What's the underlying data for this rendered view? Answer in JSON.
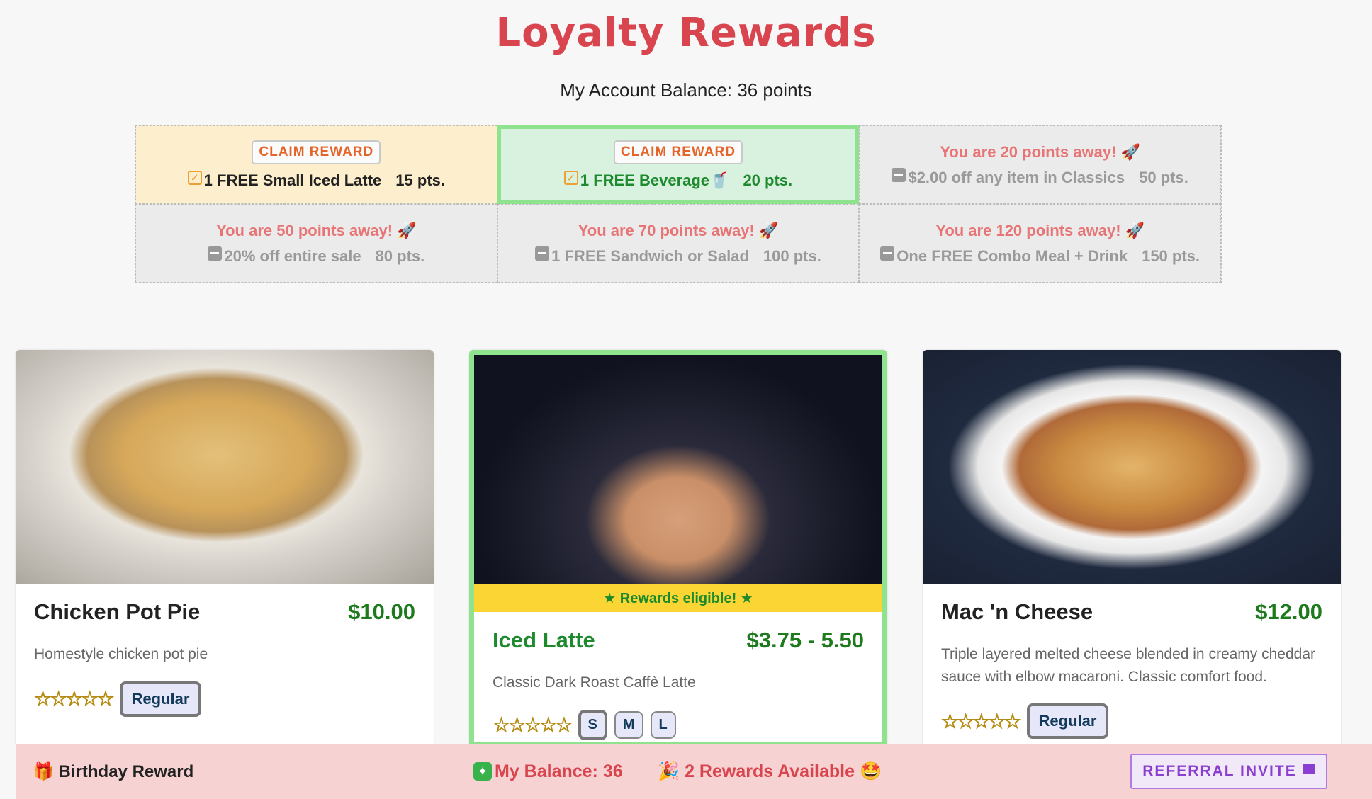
{
  "header": {
    "title": "Loyalty Rewards",
    "balance_text": "My Account Balance: 36 points"
  },
  "rewards": [
    {
      "status": "claimable",
      "claim_label": "CLAIM REWARD",
      "name": "1 FREE Small Iced Latte",
      "points": "15 pts."
    },
    {
      "status": "claimable",
      "claim_label": "CLAIM REWARD",
      "name": "1 FREE Beverage🥤",
      "points": "20 pts."
    },
    {
      "status": "locked",
      "away_text": "You are 20 points away! 🚀",
      "name": "$2.00 off any item in Classics",
      "points": "50 pts."
    },
    {
      "status": "locked",
      "away_text": "You are 50 points away! 🚀",
      "name": "20% off entire sale",
      "points": "80 pts."
    },
    {
      "status": "locked",
      "away_text": "You are 70 points away! 🚀",
      "name": "1 FREE Sandwich or Salad",
      "points": "100 pts."
    },
    {
      "status": "locked",
      "away_text": "You are 120 points away! 🚀",
      "name": "One FREE Combo Meal + Drink",
      "points": "150 pts."
    }
  ],
  "products": [
    {
      "name": "Chicken Pot Pie",
      "price": "$10.00",
      "description": "Homestyle chicken pot pie",
      "stars": "☆☆☆☆☆",
      "options": [
        "Regular"
      ]
    },
    {
      "name": "Iced Latte",
      "price": "$3.75 - 5.50",
      "banner": "★ Rewards eligible! ★",
      "description": "Classic Dark Roast Caffè Latte",
      "stars": "☆☆☆☆☆",
      "options": [
        "S",
        "M",
        "L"
      ],
      "selected_option": "S"
    },
    {
      "name": "Mac 'n Cheese",
      "price": "$12.00",
      "description": "Triple layered melted cheese blended in creamy cheddar sauce with elbow macaroni. Classic comfort food.",
      "stars": "☆☆☆☆☆",
      "options": [
        "Regular"
      ]
    }
  ],
  "footer": {
    "birthday": "🎁 Birthday Reward",
    "balance": "My Balance: 36",
    "balance_icon": "✦",
    "rewards_available": "🎉 2 Rewards Available 🤩",
    "referral_label": "REFERRAL INVITE"
  },
  "colors": {
    "title": "#d9454f",
    "claim_highlight": "#8fe38f",
    "price": "#1d7a1d",
    "banner": "#fbd534",
    "footer_bg": "#f7d2d2",
    "referral": "#8a3fd1"
  }
}
